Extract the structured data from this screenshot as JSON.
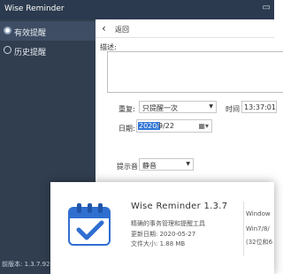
{
  "window": {
    "title": "Wise Reminder",
    "controls": "▭"
  },
  "sidebar": {
    "items": [
      {
        "label": "有效提醒",
        "active": true
      },
      {
        "label": "历史提醒",
        "active": false
      }
    ],
    "version_prefix": "前版本: 1.3.7.92"
  },
  "main": {
    "back_label": "返回",
    "description_label": "描述:",
    "description_value": "",
    "repeat_label": "重复:",
    "repeat_value": "只提醒一次",
    "time_label": "时间",
    "time_value": "13:37:01",
    "date_label": "日期:",
    "date_year": "2020/",
    "date_rest": " 9/22",
    "sound_label": "提示音",
    "sound_value": "静音"
  },
  "popup": {
    "app_name": "Wise Reminder 1.3.7",
    "tagline": "精确的事务管理和提醒工具",
    "updated": "更新日期: 2020-05-27",
    "size": "文件大小: 1.88 MB",
    "req_os": "Window",
    "req_ver": "Win7/8/",
    "req_bits": "(32位和6",
    "accent_color": "#2f6fd0"
  }
}
